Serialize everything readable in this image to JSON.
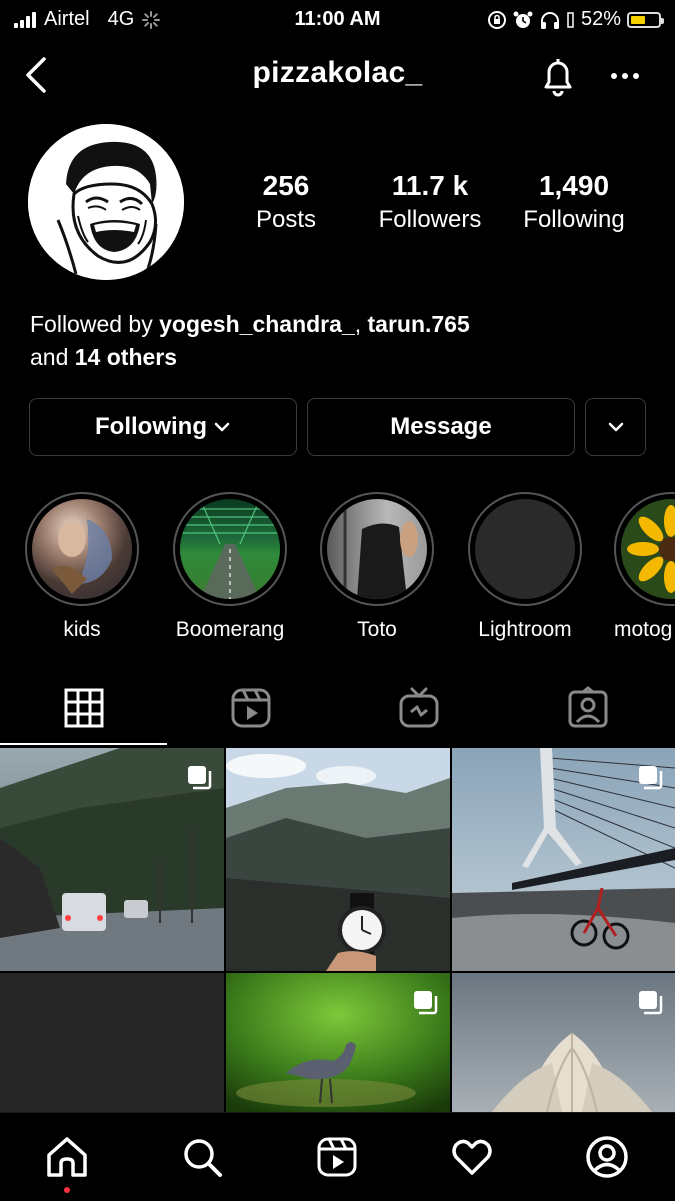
{
  "status_bar": {
    "carrier": "Airtel",
    "network": "4G",
    "time": "11:00 AM",
    "battery": "52%",
    "battery_level": 0.52
  },
  "header": {
    "username": "pizzakolac_"
  },
  "profile": {
    "stats": [
      {
        "value": "256",
        "label": "Posts"
      },
      {
        "value": "11.7 k",
        "label": "Followers"
      },
      {
        "value": "1,490",
        "label": "Following"
      }
    ],
    "followed_by": {
      "prefix": "Followed by ",
      "user1": "yogesh_chandra_",
      "separator": ", ",
      "user2": "tarun.765",
      "and": "and ",
      "others": "14 others"
    }
  },
  "actions": {
    "following": "Following",
    "message": "Message"
  },
  "highlights": [
    {
      "label": "kids"
    },
    {
      "label": "Boomerang"
    },
    {
      "label": "Toto"
    },
    {
      "label": "Lightroom"
    },
    {
      "label": "motog"
    }
  ],
  "tabs": [
    "grid-icon",
    "reels-icon",
    "igtv-icon",
    "tagged-icon"
  ],
  "nav": [
    "home-icon",
    "search-icon",
    "reels-icon",
    "heart-icon",
    "profile-icon"
  ],
  "colors": {
    "background": "#000000",
    "border": "#3a3a3a",
    "notification_dot": "#ff3040",
    "battery": "#f7d000"
  }
}
